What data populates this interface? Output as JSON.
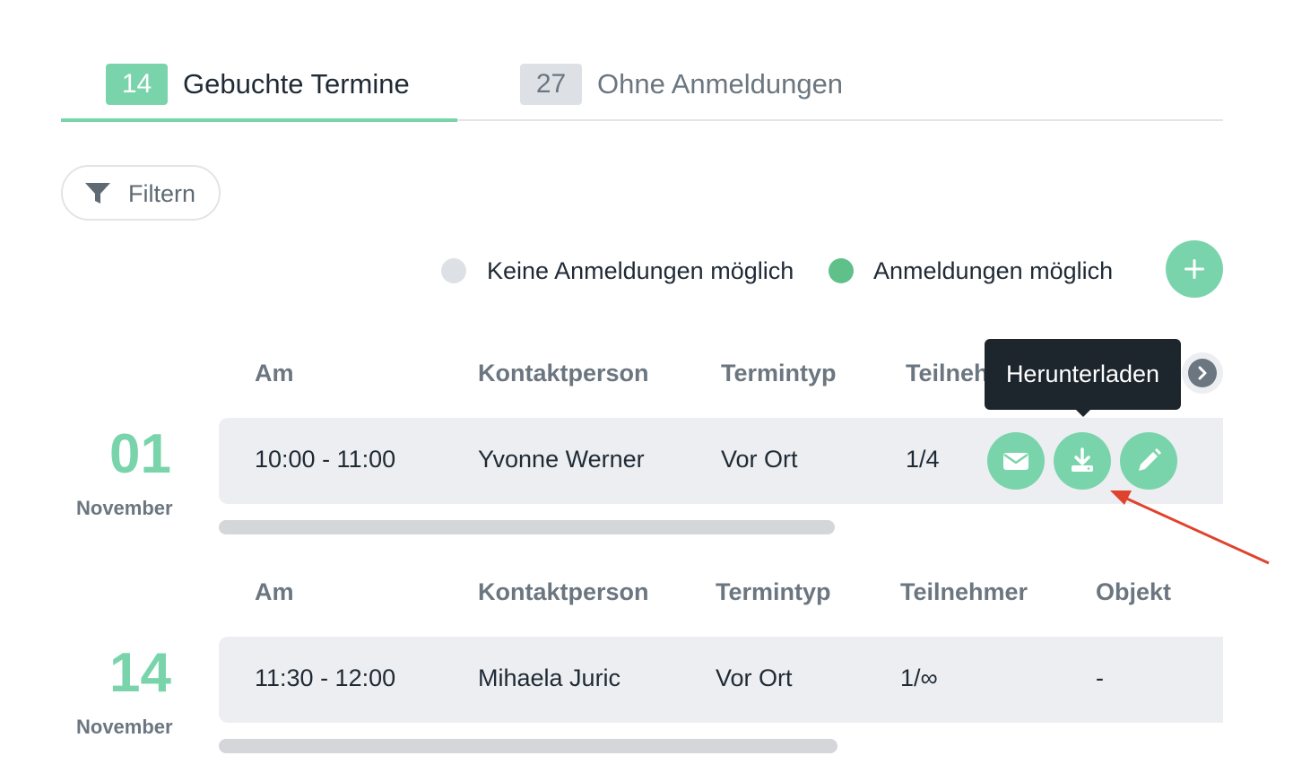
{
  "tabs": [
    {
      "count": "14",
      "label": "Gebuchte Termine",
      "active": true
    },
    {
      "count": "27",
      "label": "Ohne Anmeldungen",
      "active": false
    }
  ],
  "filter": {
    "label": "Filtern",
    "icon": "funnel-icon"
  },
  "legend": [
    {
      "label": "Keine Anmeldungen möglich",
      "color": "#dde1e6"
    },
    {
      "label": "Anmeldungen möglich",
      "color": "#5fc08a"
    }
  ],
  "add_button": {
    "icon": "plus-icon"
  },
  "colors": {
    "accent": "#7ad4ab",
    "row_bg": "#eceef1",
    "tooltip_bg": "#1d252d",
    "annotation_arrow": "#e0432d"
  },
  "tooltip": {
    "text": "Herunterladen"
  },
  "groups": [
    {
      "day": "01",
      "month": "November",
      "headers": {
        "am": "Am",
        "kontakt": "Kontaktperson",
        "typ": "Termintyp",
        "teilnehmer": "Teilneh"
      },
      "row": {
        "time": "10:00 - 11:00",
        "contact": "Yvonne Werner",
        "type": "Vor Ort",
        "participants": "1/4"
      },
      "actions": [
        "mail-icon",
        "download-icon",
        "edit-pencil-icon"
      ]
    },
    {
      "day": "14",
      "month": "November",
      "headers": {
        "am": "Am",
        "kontakt": "Kontaktperson",
        "typ": "Termintyp",
        "teilnehmer": "Teilnehmer",
        "objekt": "Objekt"
      },
      "row": {
        "time": "11:30 - 12:00",
        "contact": "Mihaela Juric",
        "type": "Vor Ort",
        "participants": "1/∞",
        "object": "-"
      }
    }
  ]
}
